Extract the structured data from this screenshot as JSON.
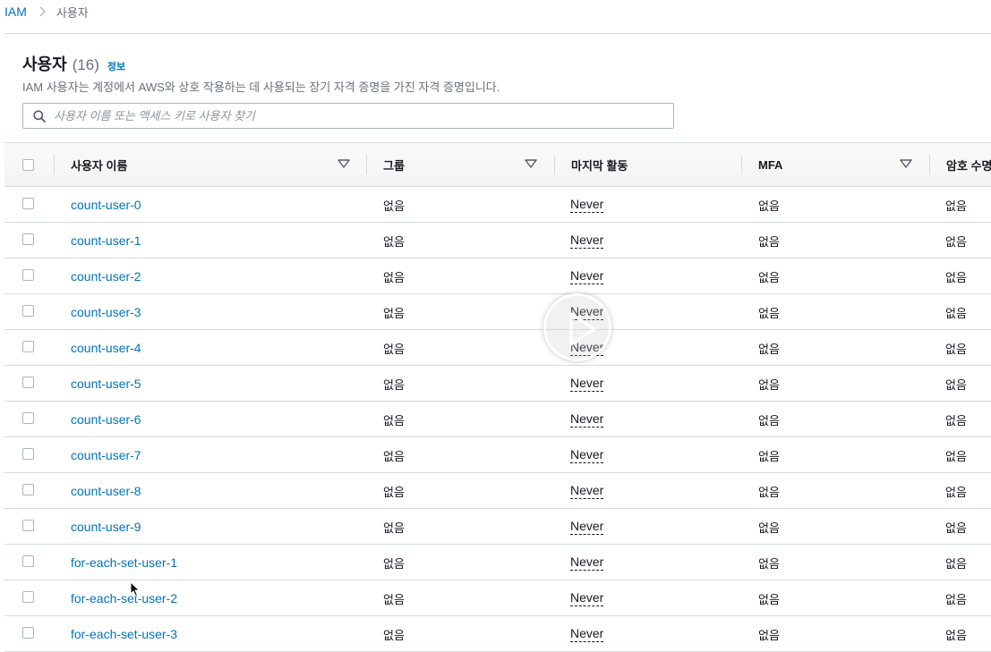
{
  "breadcrumb": {
    "root": "IAM",
    "current": "사용자"
  },
  "header": {
    "title": "사용자",
    "count": "(16)",
    "info_link": "정보",
    "description": "IAM 사용자는 계정에서 AWS와 상호 작용하는 데 사용되는 장기 자격 증명을 가진 자격 증명입니다."
  },
  "search": {
    "placeholder": "사용자 이름 또는 액세스 키로 사용자 찾기",
    "value": ""
  },
  "table": {
    "columns": [
      "사용자 이름",
      "그룹",
      "마지막 활동",
      "MFA",
      "암호 수명"
    ],
    "rows": [
      {
        "name": "count-user-0",
        "group": "없음",
        "last_activity": "Never",
        "mfa": "없음",
        "password_age": "없음"
      },
      {
        "name": "count-user-1",
        "group": "없음",
        "last_activity": "Never",
        "mfa": "없음",
        "password_age": "없음"
      },
      {
        "name": "count-user-2",
        "group": "없음",
        "last_activity": "Never",
        "mfa": "없음",
        "password_age": "없음"
      },
      {
        "name": "count-user-3",
        "group": "없음",
        "last_activity": "Never",
        "mfa": "없음",
        "password_age": "없음"
      },
      {
        "name": "count-user-4",
        "group": "없음",
        "last_activity": "Never",
        "mfa": "없음",
        "password_age": "없음"
      },
      {
        "name": "count-user-5",
        "group": "없음",
        "last_activity": "Never",
        "mfa": "없음",
        "password_age": "없음"
      },
      {
        "name": "count-user-6",
        "group": "없음",
        "last_activity": "Never",
        "mfa": "없음",
        "password_age": "없음"
      },
      {
        "name": "count-user-7",
        "group": "없음",
        "last_activity": "Never",
        "mfa": "없음",
        "password_age": "없음"
      },
      {
        "name": "count-user-8",
        "group": "없음",
        "last_activity": "Never",
        "mfa": "없음",
        "password_age": "없음"
      },
      {
        "name": "count-user-9",
        "group": "없음",
        "last_activity": "Never",
        "mfa": "없음",
        "password_age": "없음"
      },
      {
        "name": "for-each-set-user-1",
        "group": "없음",
        "last_activity": "Never",
        "mfa": "없음",
        "password_age": "없음"
      },
      {
        "name": "for-each-set-user-2",
        "group": "없음",
        "last_activity": "Never",
        "mfa": "없음",
        "password_age": "없음"
      },
      {
        "name": "for-each-set-user-3",
        "group": "없음",
        "last_activity": "Never",
        "mfa": "없음",
        "password_age": "없음"
      }
    ]
  },
  "colors": {
    "link": "#0073bb",
    "text": "#16191f",
    "muted": "#687078",
    "border": "#d5dbdb"
  },
  "icons": {
    "search": "search-icon",
    "sort": "sort-caret-icon",
    "separator": "chevron-right-icon",
    "overlay": "play-icon",
    "pointer": "mouse-cursor-icon"
  }
}
